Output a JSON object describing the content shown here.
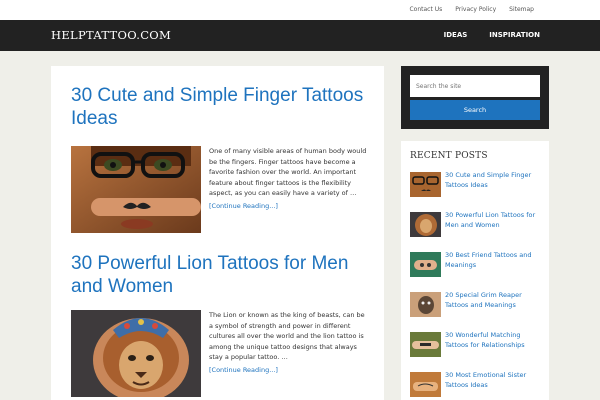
{
  "topbar": {
    "links": [
      "Contact Us",
      "Privacy Policy",
      "Sitemap"
    ]
  },
  "header": {
    "site_title": "HELPTATTOO.COM",
    "nav": [
      "IDEAS",
      "INSPIRATION"
    ]
  },
  "posts": [
    {
      "title": "30 Cute and Simple Finger Tattoos Ideas",
      "excerpt": "One of many visible areas of human body would be the fingers. Finger tattoos have become a favorite fashion over the world. An important feature about finger tattoos is the flexibility aspect, as you can easily have a variety of …",
      "more": "[Continue Reading...]"
    },
    {
      "title": "30 Powerful Lion Tattoos for Men and Women",
      "excerpt": "The Lion or known as the king of beasts, can be a symbol of strength and power in different cultures all over the world and the lion tattoo is among the unique tattoo designs that always stay a popular tattoo. …",
      "more": "[Continue Reading...]"
    }
  ],
  "search": {
    "placeholder": "Search the site",
    "button": "Search"
  },
  "recent_posts": {
    "title": "RECENT POSTS",
    "items": [
      "30 Cute and Simple Finger Tattoos Ideas",
      "30 Powerful Lion Tattoos for Men and Women",
      "30 Best Friend Tattoos and Meanings",
      "20 Special Grim Reaper Tattoos and Meanings",
      "30 Wonderful Matching Tattoos for Relationships",
      "30 Most Emotional Sister Tattoos Ideas"
    ]
  }
}
